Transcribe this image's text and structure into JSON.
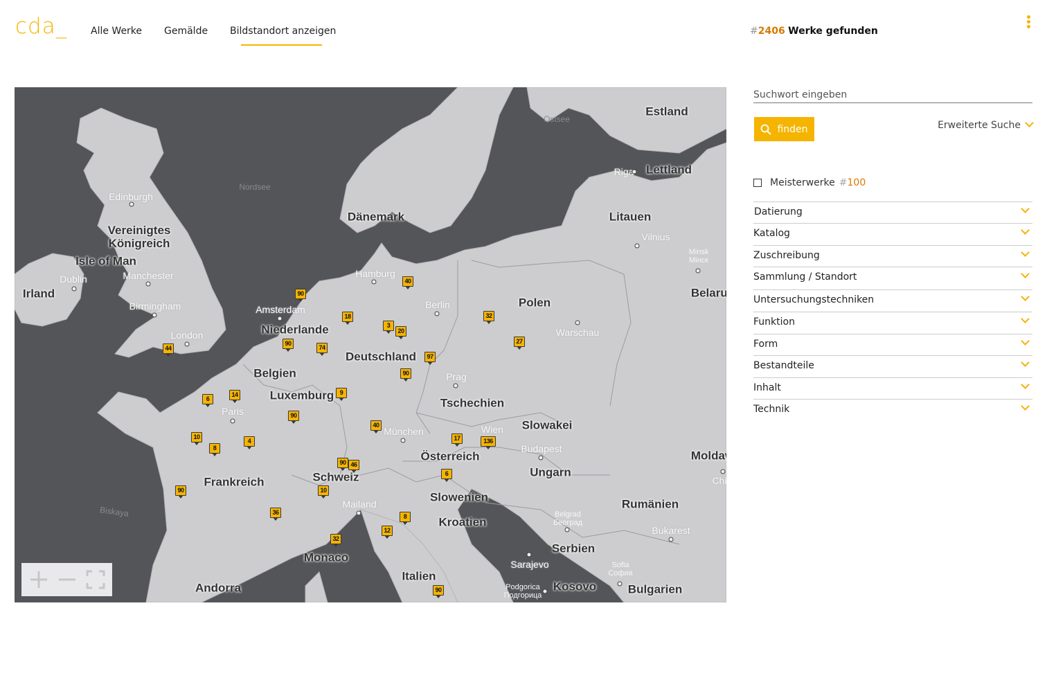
{
  "header": {
    "logo": "cda_",
    "nav": [
      {
        "label": "Alle Werke",
        "active": false
      },
      {
        "label": "Gemälde",
        "active": false
      },
      {
        "label": "Bildstandort anzeigen",
        "active": true
      }
    ],
    "result_hash": "#",
    "result_count": "2406",
    "result_label": "Werke gefunden"
  },
  "colors": {
    "accent": "#f5b400",
    "count": "#d77a00",
    "water": "#545559",
    "land": "#cdcdd0"
  },
  "map": {
    "countries": [
      {
        "label": "Estland"
      },
      {
        "label": "Lettland"
      },
      {
        "label": "Litauen"
      },
      {
        "label": "Dänemark"
      },
      {
        "label": "Vereinigtes\nKönigreich"
      },
      {
        "label": "Irland"
      },
      {
        "label": "Polen"
      },
      {
        "label": "Belarus"
      },
      {
        "label": "Niederlande"
      },
      {
        "label": "Belgien"
      },
      {
        "label": "Luxemburg"
      },
      {
        "label": "Deutschland"
      },
      {
        "label": "Tschechien"
      },
      {
        "label": "Slowakei"
      },
      {
        "label": "Österreich"
      },
      {
        "label": "Ungarn"
      },
      {
        "label": "Moldaw"
      },
      {
        "label": "Frankreich"
      },
      {
        "label": "Schweiz"
      },
      {
        "label": "Slowenien"
      },
      {
        "label": "Kroatien"
      },
      {
        "label": "Rumänien"
      },
      {
        "label": "Serbien"
      },
      {
        "label": "Monaco"
      },
      {
        "label": "Italien"
      },
      {
        "label": "Andorra"
      },
      {
        "label": "Kosovo"
      },
      {
        "label": "Bulgarien"
      },
      {
        "label": "Isle of Man"
      }
    ],
    "cities": [
      {
        "label": "Edinburgh"
      },
      {
        "label": "Dublin"
      },
      {
        "label": "Manchester"
      },
      {
        "label": "Birmingham"
      },
      {
        "label": "London"
      },
      {
        "label": "Amsterdam"
      },
      {
        "label": "Hamburg"
      },
      {
        "label": "Berlin"
      },
      {
        "label": "Riga"
      },
      {
        "label": "Vilnius"
      },
      {
        "label": "Warschau"
      },
      {
        "label": "Prag"
      },
      {
        "label": "Paris"
      },
      {
        "label": "München"
      },
      {
        "label": "Wien"
      },
      {
        "label": "Budapest"
      },
      {
        "label": "Mailand"
      },
      {
        "label": "Bukarest"
      },
      {
        "label": "Sarajevo"
      },
      {
        "label": "Chisi"
      }
    ],
    "small_labels": [
      {
        "label": "Minsk\nМінск"
      },
      {
        "label": "Belgrad\nБеоград"
      },
      {
        "label": "Sofia\nСофия"
      },
      {
        "label": "Podgorica\nПодгорица"
      }
    ],
    "seas": [
      {
        "label": "Nordsee"
      },
      {
        "label": "Ostsee"
      },
      {
        "label": "Biskaya"
      }
    ],
    "markers": [
      {
        "count": "90"
      },
      {
        "count": "40"
      },
      {
        "count": "18"
      },
      {
        "count": "3"
      },
      {
        "count": "20"
      },
      {
        "count": "32"
      },
      {
        "count": "27"
      },
      {
        "count": "90"
      },
      {
        "count": "74"
      },
      {
        "count": "97"
      },
      {
        "count": "44"
      },
      {
        "count": "90"
      },
      {
        "count": "9"
      },
      {
        "count": "6"
      },
      {
        "count": "14"
      },
      {
        "count": "90"
      },
      {
        "count": "40"
      },
      {
        "count": "17"
      },
      {
        "count": "136"
      },
      {
        "count": "10"
      },
      {
        "count": "8"
      },
      {
        "count": "4"
      },
      {
        "count": "90"
      },
      {
        "count": "46"
      },
      {
        "count": "6"
      },
      {
        "count": "90"
      },
      {
        "count": "10"
      },
      {
        "count": "36"
      },
      {
        "count": "8"
      },
      {
        "count": "12"
      },
      {
        "count": "32"
      },
      {
        "count": "90"
      }
    ]
  },
  "search": {
    "placeholder": "Suchwort eingeben",
    "button": "finden",
    "advanced": "Erweiterte Suche"
  },
  "masterworks": {
    "label": "Meisterwerke",
    "hash": "#",
    "count": "100"
  },
  "facets": [
    "Datierung",
    "Katalog",
    "Zuschreibung",
    "Sammlung / Standort",
    "Untersuchungstechniken",
    "Funktion",
    "Form",
    "Bestandteile",
    "Inhalt",
    "Technik"
  ]
}
